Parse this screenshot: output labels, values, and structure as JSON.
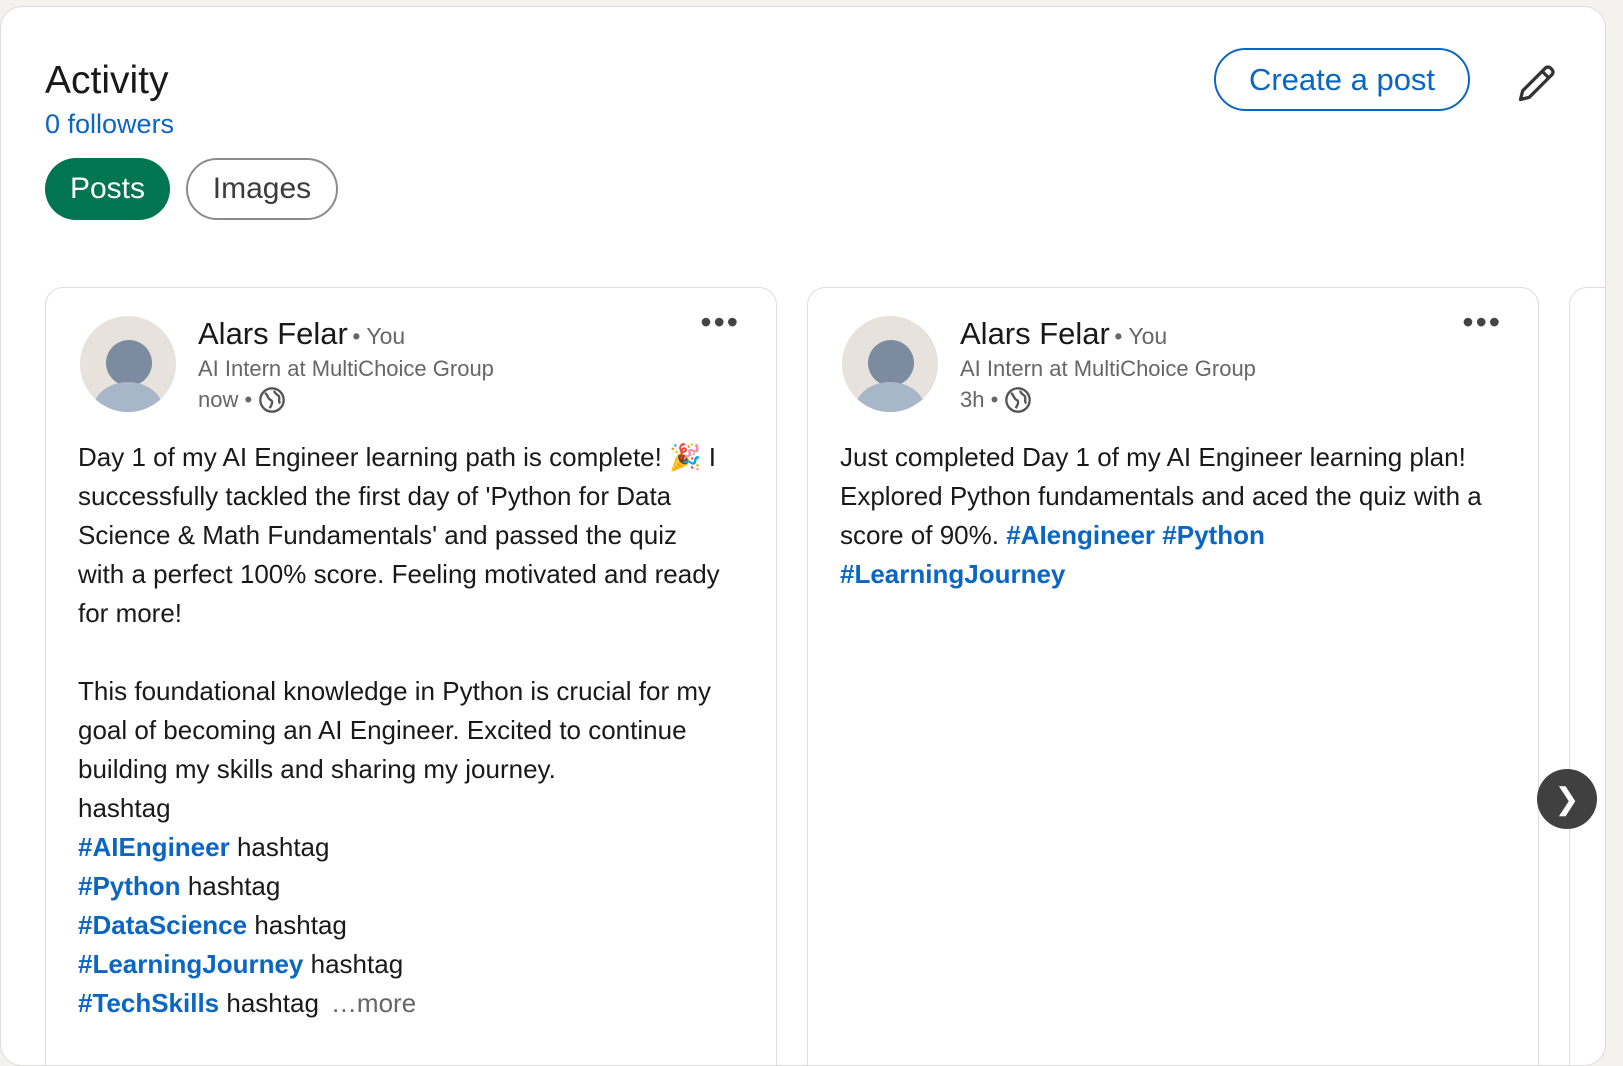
{
  "header": {
    "title": "Activity",
    "followers": "0 followers",
    "create_post": "Create a post",
    "edit_icon": "pencil-icon"
  },
  "filters": {
    "active": "Posts",
    "inactive": "Images"
  },
  "posts": [
    {
      "author": "Alars Felar",
      "you": "• You",
      "headline": "AI Intern at MultiChoice Group",
      "time": "now •",
      "more_icon": "more-dots-icon",
      "text_p1": "Day 1 of my AI Engineer learning path is complete! 🎉 I successfully tackled the first day of 'Python for Data Science & Math Fundamentals' and passed the quiz with a perfect 100% score. Feeling motivated and ready for more!",
      "text_p2": "This foundational knowledge in Python is crucial for my goal of becoming an AI Engineer. Excited to continue building my skills and sharing my journey.",
      "hashtag_word": "hashtag",
      "tags": [
        "#AIEngineer",
        "#Python",
        "#DataScience",
        "#LearningJourney",
        "#TechSkills"
      ],
      "see_more": "…more"
    },
    {
      "author": "Alars Felar",
      "you": "• You",
      "headline": "AI Intern at MultiChoice Group",
      "time": "3h •",
      "more_icon": "more-dots-icon",
      "text": "Just completed Day 1 of my AI Engineer learning plan! Explored Python fundamentals and aced the quiz with a score of 90%.",
      "tags": [
        "#AIengineer",
        "#Python",
        "#LearningJourney"
      ]
    }
  ],
  "carousel": {
    "next_label": "❯"
  },
  "colors": {
    "accent": "#0a66c2",
    "active_pill": "#01754f",
    "arrow_bg": "#404040"
  }
}
